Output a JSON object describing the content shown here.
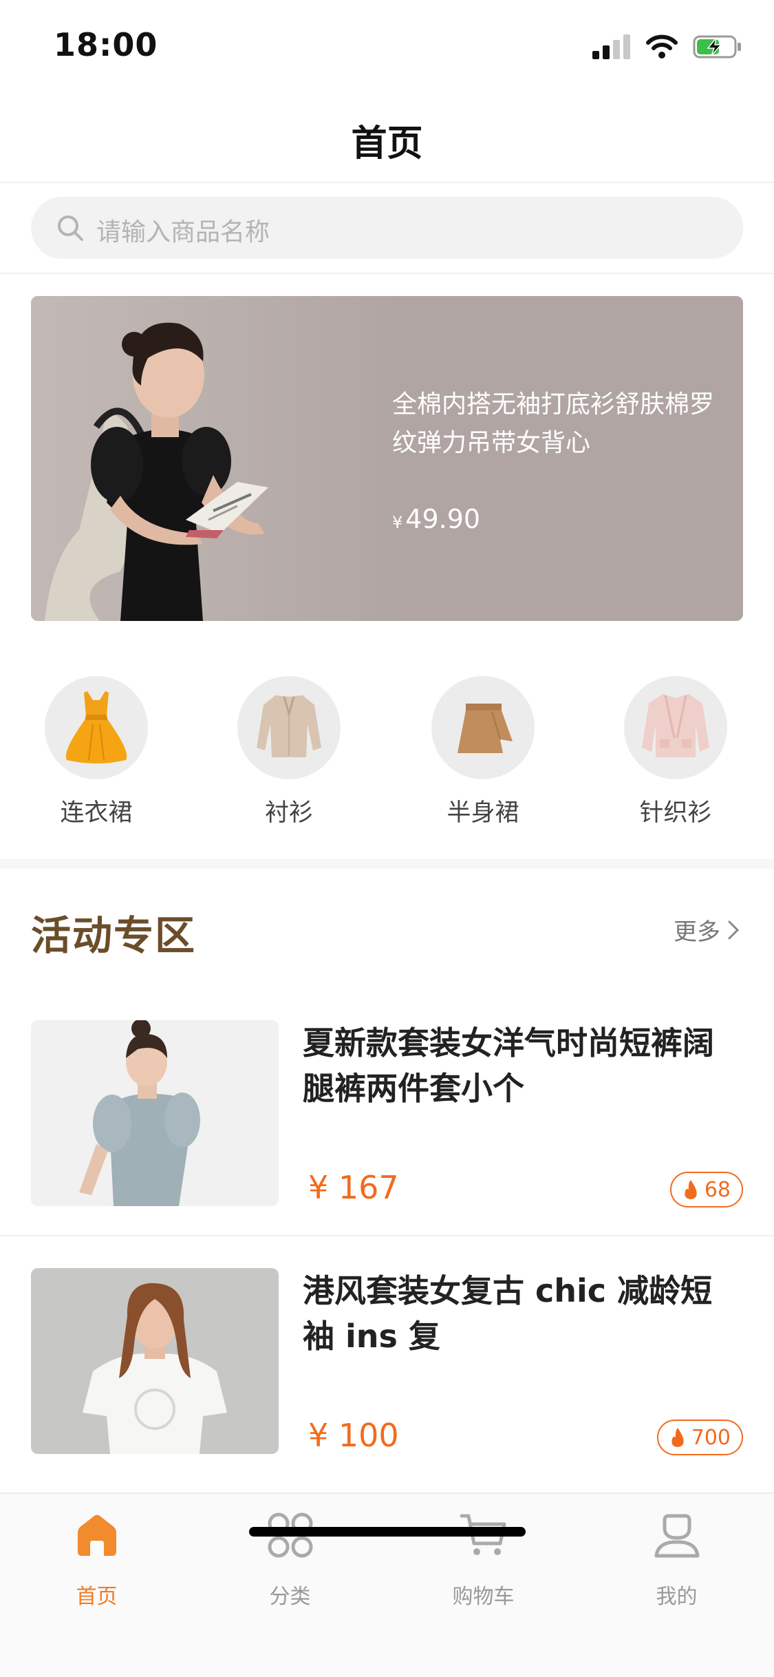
{
  "status_bar": {
    "time": "18:00"
  },
  "nav": {
    "title": "首页"
  },
  "search": {
    "placeholder": "请输入商品名称"
  },
  "banner": {
    "title": "全棉内搭无袖打底衫舒肤棉罗纹弹力吊带女背心",
    "currency": "¥",
    "price": "49.90"
  },
  "categories": [
    {
      "label": "连衣裙",
      "icon": "dress-icon"
    },
    {
      "label": "衬衫",
      "icon": "shirt-icon"
    },
    {
      "label": "半身裙",
      "icon": "skirt-icon"
    },
    {
      "label": "针织衫",
      "icon": "cardigan-icon"
    }
  ],
  "activity": {
    "title": "活动专区",
    "more_label": "更多",
    "products": [
      {
        "name": "夏新款套装女洋气时尚短裤阔腿裤两件套小个",
        "price": "¥ 167",
        "hot": "68"
      },
      {
        "name": "港风套装女复古 chic 减龄短袖 ins 复",
        "price": "¥ 100",
        "hot": "700"
      }
    ]
  },
  "tabs": [
    {
      "label": "首页",
      "icon": "home-icon",
      "active": true
    },
    {
      "label": "分类",
      "icon": "category-icon",
      "active": false
    },
    {
      "label": "购物车",
      "icon": "cart-icon",
      "active": false
    },
    {
      "label": "我的",
      "icon": "profile-icon",
      "active": false
    }
  ],
  "colors": {
    "accent": "#f27b21",
    "price": "#f26b1d",
    "section_title": "#6b4d2a",
    "banner_bg": "#b0a5a2"
  }
}
